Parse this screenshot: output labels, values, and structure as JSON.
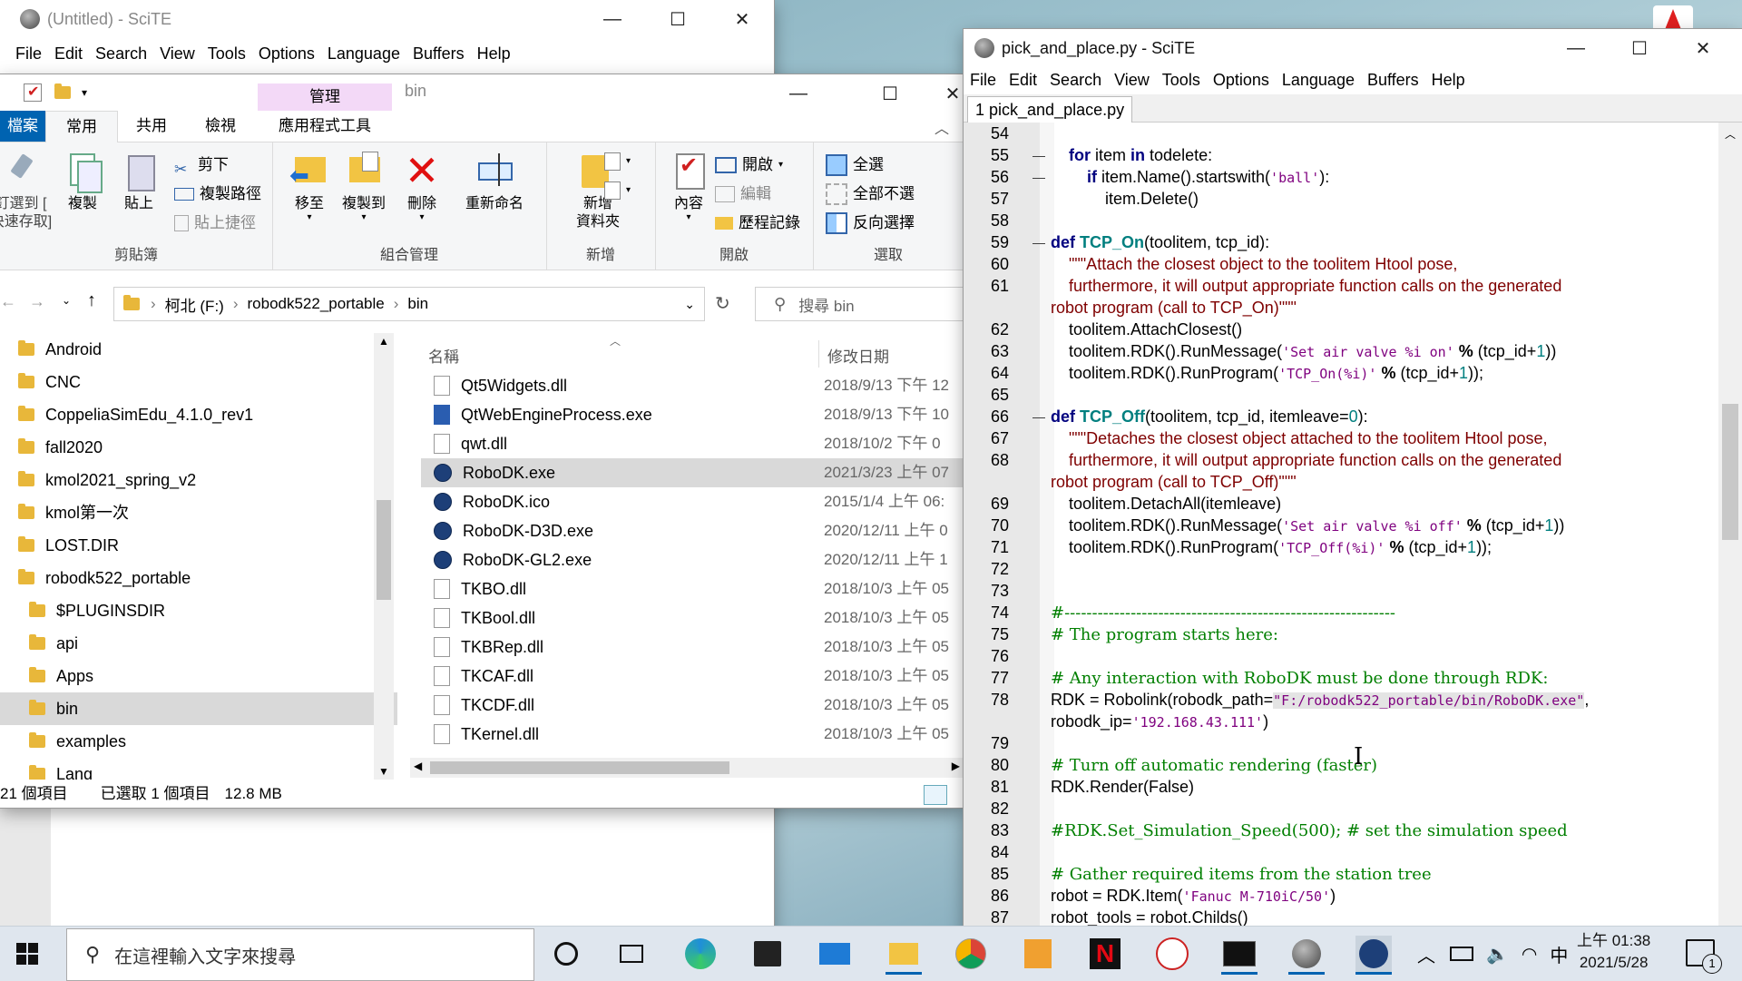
{
  "colors": {
    "accent": "#0063b1",
    "selection": "#cce8ff",
    "manage_tab": "#f3d9f7",
    "keyword": "#00007f",
    "function": "#007f7f",
    "string": "#7f007f",
    "docstring": "#7f0000",
    "comment": "#007f00"
  },
  "scite_back": {
    "title": "(Untitled) - SciTE",
    "menu": [
      "File",
      "Edit",
      "Search",
      "View",
      "Tools",
      "Options",
      "Language",
      "Buffers",
      "Help"
    ]
  },
  "explorer": {
    "title": "bin",
    "manage_tab": "管理",
    "tabs": {
      "file": "檔案",
      "home": "常用",
      "share": "共用",
      "view": "檢視",
      "app_tools": "應用程式工具"
    },
    "ribbon": {
      "pin_label": "釘選到 [\n快速存取]",
      "copy": "複製",
      "paste": "貼上",
      "cut": "剪下",
      "copy_path": "複製路徑",
      "paste_shortcut": "貼上捷徑",
      "clipboard_group": "剪貼簿",
      "move_to": "移至",
      "copy_to": "複製到",
      "delete": "刪除",
      "rename": "重新命名",
      "organize_group": "組合管理",
      "new_folder": "新增\n資料夾",
      "new_group": "新增",
      "properties": "內容",
      "open": "開啟",
      "edit": "編輯",
      "history": "歷程記錄",
      "open_group": "開啟",
      "select_all": "全選",
      "select_none": "全部不選",
      "invert": "反向選擇",
      "select_group": "選取"
    },
    "address": {
      "drive": "柯北 (F:)",
      "folder1": "robodk522_portable",
      "folder2": "bin",
      "search_placeholder": "搜尋 bin"
    },
    "tree": [
      "Android",
      "CNC",
      "CoppeliaSimEdu_4.1.0_rev1",
      "fall2020",
      "kmol2021_spring_v2",
      "kmol第一次",
      "LOST.DIR",
      "robodk522_portable",
      "$PLUGINSDIR",
      "api",
      "Apps",
      "bin",
      "examples",
      "Lang"
    ],
    "columns": {
      "name": "名稱",
      "date": "修改日期"
    },
    "files": [
      {
        "name": "Qt5Widgets.dll",
        "date": "2018/9/13 下午 12",
        "type": "dll"
      },
      {
        "name": "QtWebEngineProcess.exe",
        "date": "2018/9/13 下午 10",
        "type": "app"
      },
      {
        "name": "qwt.dll",
        "date": "2018/10/2 下午 0",
        "type": "dll"
      },
      {
        "name": "RoboDK.exe",
        "date": "2021/3/23 上午 07",
        "type": "rdk"
      },
      {
        "name": "RoboDK.ico",
        "date": "2015/1/4 上午 06:",
        "type": "rdk"
      },
      {
        "name": "RoboDK-D3D.exe",
        "date": "2020/12/11 上午 0",
        "type": "rdk"
      },
      {
        "name": "RoboDK-GL2.exe",
        "date": "2020/12/11 上午 1",
        "type": "rdk"
      },
      {
        "name": "TKBO.dll",
        "date": "2018/10/3 上午 05",
        "type": "dll"
      },
      {
        "name": "TKBool.dll",
        "date": "2018/10/3 上午 05",
        "type": "dll"
      },
      {
        "name": "TKBRep.dll",
        "date": "2018/10/3 上午 05",
        "type": "dll"
      },
      {
        "name": "TKCAF.dll",
        "date": "2018/10/3 上午 05",
        "type": "dll"
      },
      {
        "name": "TKCDF.dll",
        "date": "2018/10/3 上午 05",
        "type": "dll"
      },
      {
        "name": "TKernel.dll",
        "date": "2018/10/3 上午 05",
        "type": "dll"
      }
    ],
    "status": {
      "count": "21 個項目",
      "selected": "已選取 1 個項目",
      "size": "12.8 MB"
    }
  },
  "scite_front": {
    "title": "pick_and_place.py - SciTE",
    "menu": [
      "File",
      "Edit",
      "Search",
      "View",
      "Tools",
      "Options",
      "Language",
      "Buffers",
      "Help"
    ],
    "tab": "1 pick_and_place.py"
  },
  "taskbar": {
    "search_placeholder": "在這裡輸入文字來搜尋",
    "ime": "中",
    "time": "上午 01:38",
    "date": "2021/5/28",
    "notification_count": "1"
  }
}
